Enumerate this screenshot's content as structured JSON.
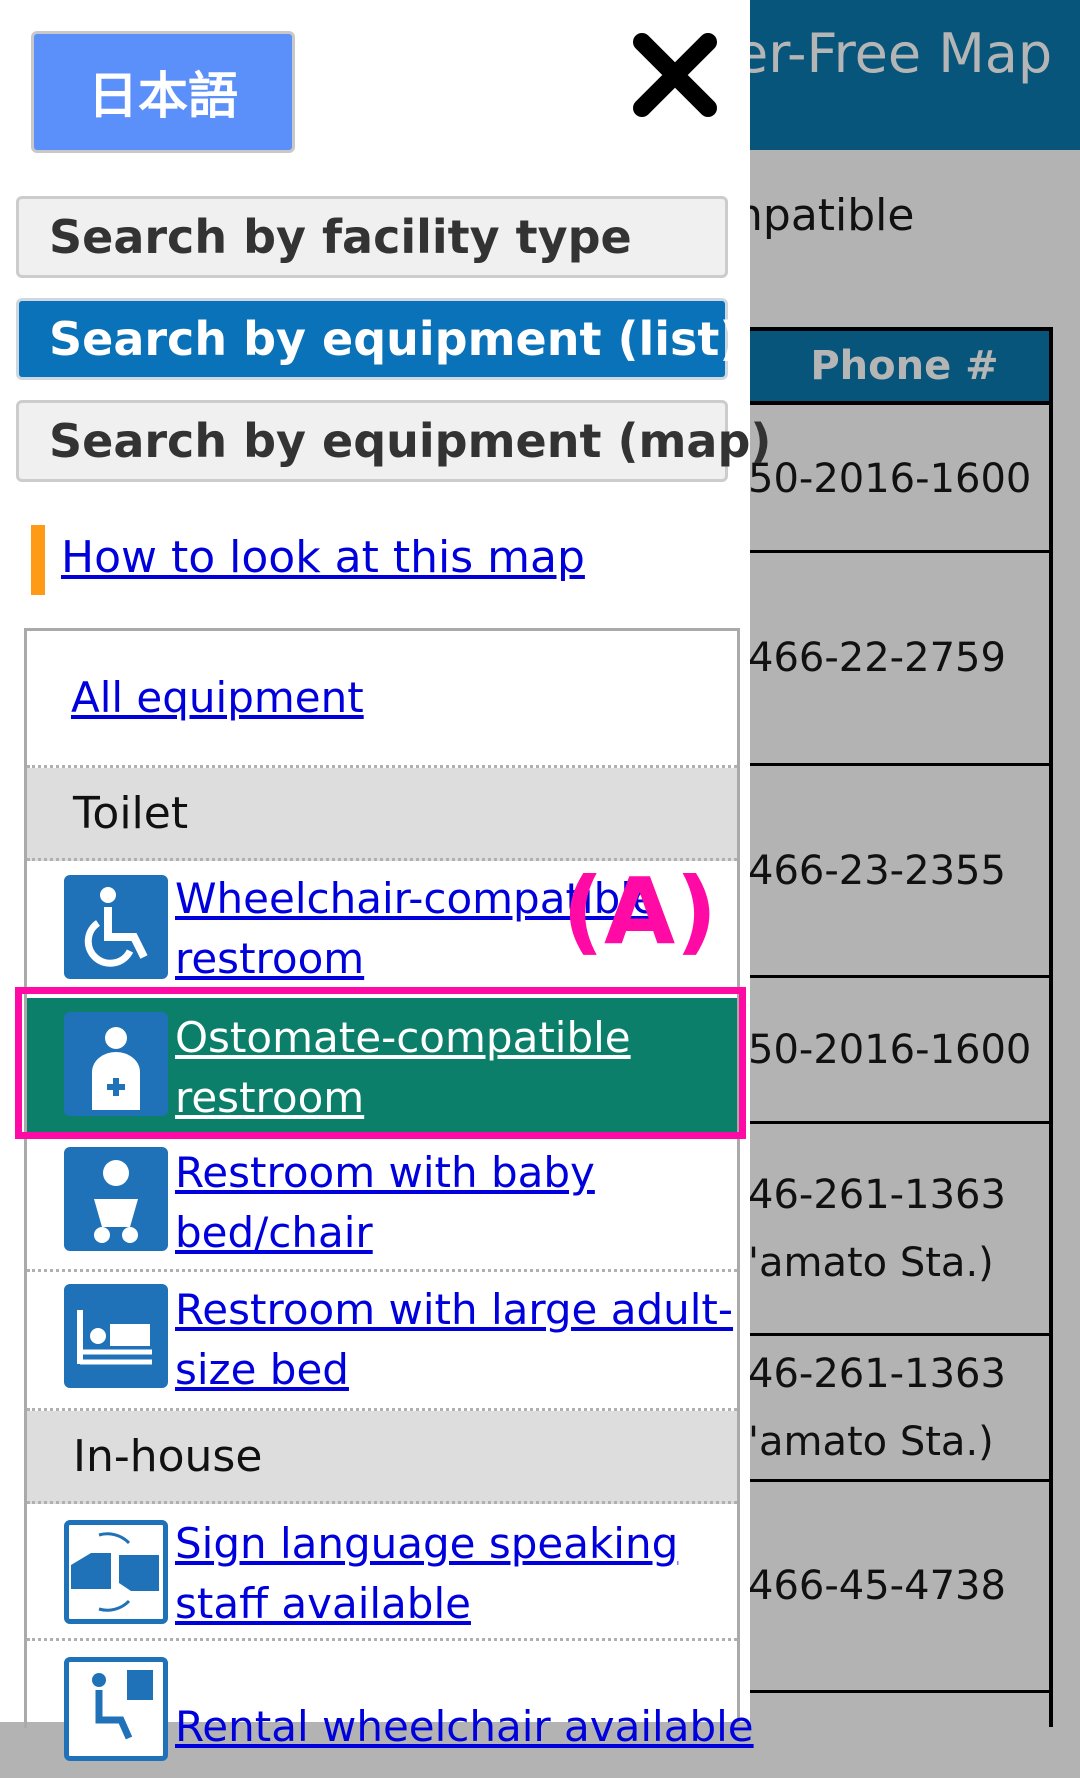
{
  "background": {
    "header_title": "er-Free Map",
    "subtitle": "npatible",
    "table": {
      "header": "Phone #",
      "rows": [
        [
          "50-2016-1600"
        ],
        [
          "466-22-2759"
        ],
        [
          "466-23-2355"
        ],
        [
          "50-2016-1600"
        ],
        [
          "46-261-1363",
          "'amato Sta.)"
        ],
        [
          "46-261-1363",
          "'amato Sta.)"
        ],
        [
          "466-45-4738"
        ],
        [
          ""
        ]
      ]
    }
  },
  "panel": {
    "language_button": "日本語",
    "close_icon": "close-x-icon",
    "search_buttons": [
      {
        "label": "Search by facility type",
        "active": false
      },
      {
        "label": "Search by equipment (list)",
        "active": true
      },
      {
        "label": "Search by equipment (map)",
        "active": false
      }
    ],
    "how_to_link": "How to look at this map",
    "all_equipment": "All equipment",
    "categories": [
      {
        "name": "Toilet",
        "items": [
          {
            "label": "Wheelchair-compatible restroom",
            "icon": "wheelchair-icon"
          },
          {
            "label": "Ostomate-compatible restroom",
            "icon": "ostomate-icon",
            "selected": true
          },
          {
            "label": "Restroom with baby bed/chair",
            "icon": "baby-icon"
          },
          {
            "label": "Restroom with large adult-size bed",
            "icon": "adult-bed-icon"
          }
        ]
      },
      {
        "name": "In-house",
        "items": [
          {
            "label": "Sign language speaking staff available",
            "icon": "sign-language-icon"
          },
          {
            "label": "Rental wheelchair available",
            "icon": "rental-wheelchair-icon"
          }
        ]
      }
    ]
  },
  "annotation": "(A)",
  "colors": {
    "header": "#07557a",
    "active": "#0a72b8",
    "selected_row": "#0b7f6a",
    "highlight": "#ff0aa5",
    "link": "#0000dd",
    "accent_bar": "#ff9a16"
  }
}
